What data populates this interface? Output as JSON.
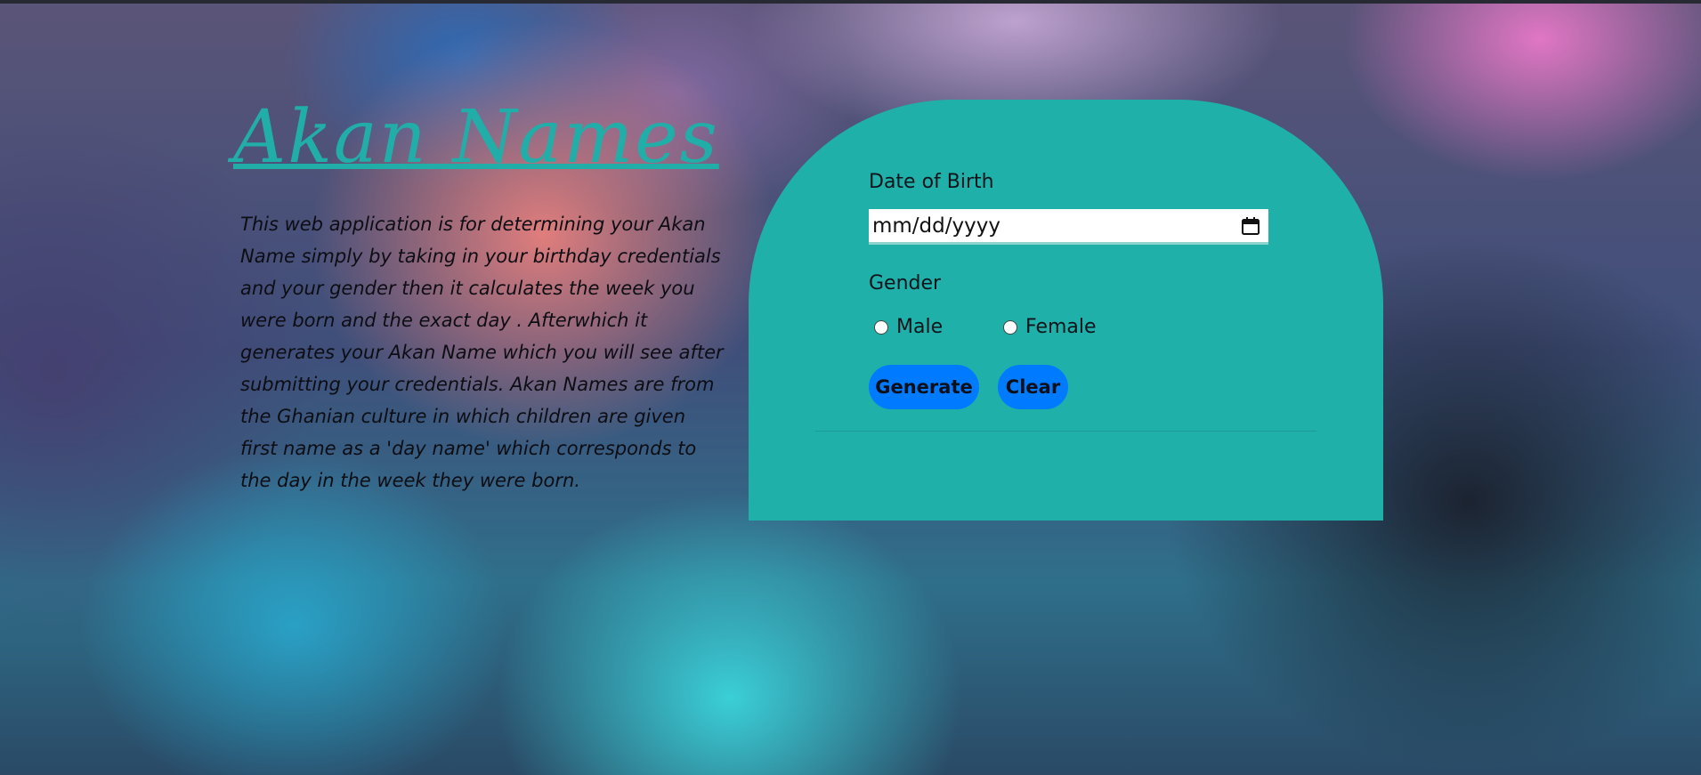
{
  "header": {
    "title": "Akan Names"
  },
  "description": "This web application is for determining your Akan Name simply by taking in your birthday credentials and your gender then it calculates the week you were born and the exact day . Afterwhich it generates your Akan Name which you will see after submitting your credentials. Akan Names are from the Ghanian culture in which children are given first name as a 'day name' which corresponds to the day in the week they were born.",
  "form": {
    "dob_label": "Date of Birth",
    "dob_placeholder": "mm/dd/yyyy",
    "calendar_icon": "calendar-icon",
    "gender_label": "Gender",
    "gender_options": [
      "Male",
      "Female"
    ],
    "generate_label": "Generate",
    "clear_label": "Clear"
  },
  "colors": {
    "accent": "#20b0aa",
    "title": "#21aea8",
    "button": "#007bff"
  }
}
